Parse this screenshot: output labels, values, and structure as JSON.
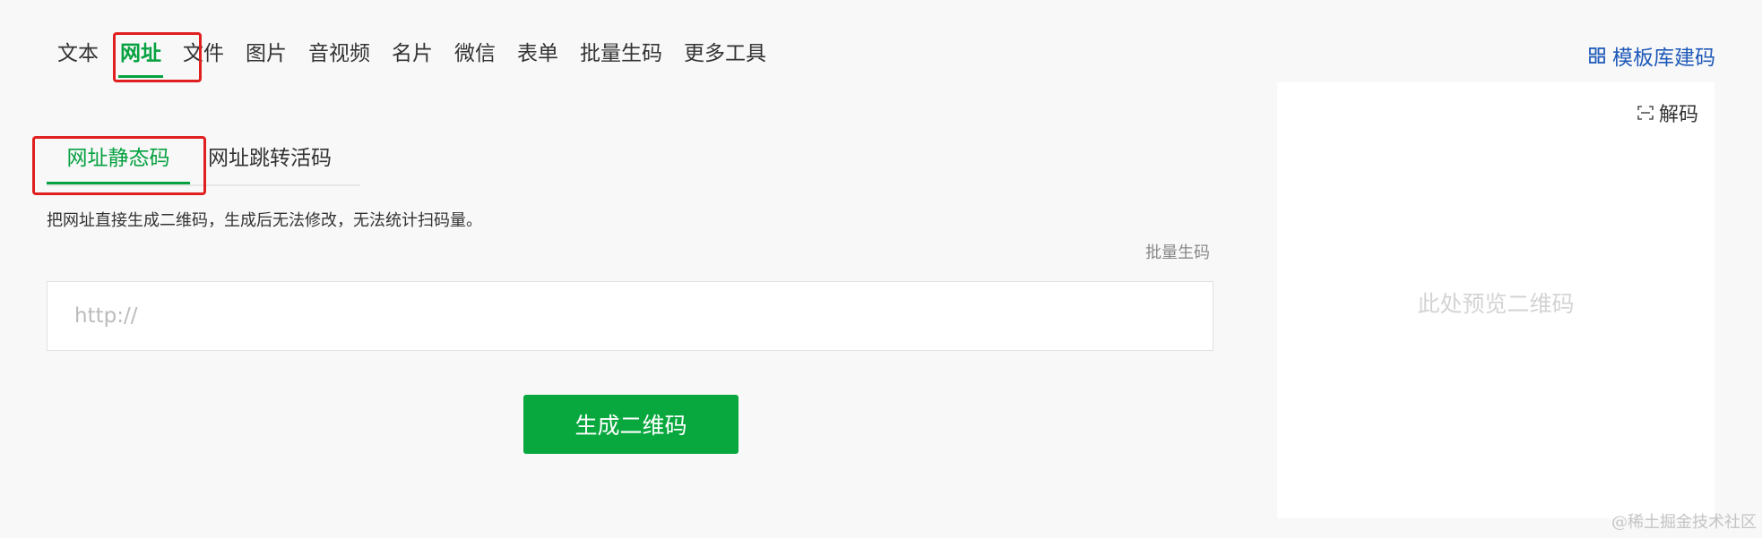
{
  "top_tabs": [
    {
      "label": "文本",
      "active": false
    },
    {
      "label": "网址",
      "active": true
    },
    {
      "label": "文件",
      "active": false
    },
    {
      "label": "图片",
      "active": false
    },
    {
      "label": "音视频",
      "active": false
    },
    {
      "label": "名片",
      "active": false
    },
    {
      "label": "微信",
      "active": false
    },
    {
      "label": "表单",
      "active": false
    },
    {
      "label": "批量生码",
      "active": false
    },
    {
      "label": "更多工具",
      "active": false
    }
  ],
  "template_link": {
    "label": "模板库建码",
    "icon": "grid-icon"
  },
  "sub_tabs": [
    {
      "label": "网址静态码",
      "active": true
    },
    {
      "label": "网址跳转活码",
      "active": false
    }
  ],
  "description": "把网址直接生成二维码，生成后无法修改，无法统计扫码量。",
  "batch_link": "批量生码",
  "url_input": {
    "placeholder": "http://",
    "value": ""
  },
  "generate_button": "生成二维码",
  "preview": {
    "decode_label": "解码",
    "decode_icon": "scan-icon",
    "placeholder": "此处预览二维码"
  },
  "watermark": "@稀土掘金技术社区",
  "colors": {
    "accent": "#06a140",
    "link": "#1f5ab9",
    "highlight_box": "#e02020",
    "background": "#f8f8f8"
  }
}
